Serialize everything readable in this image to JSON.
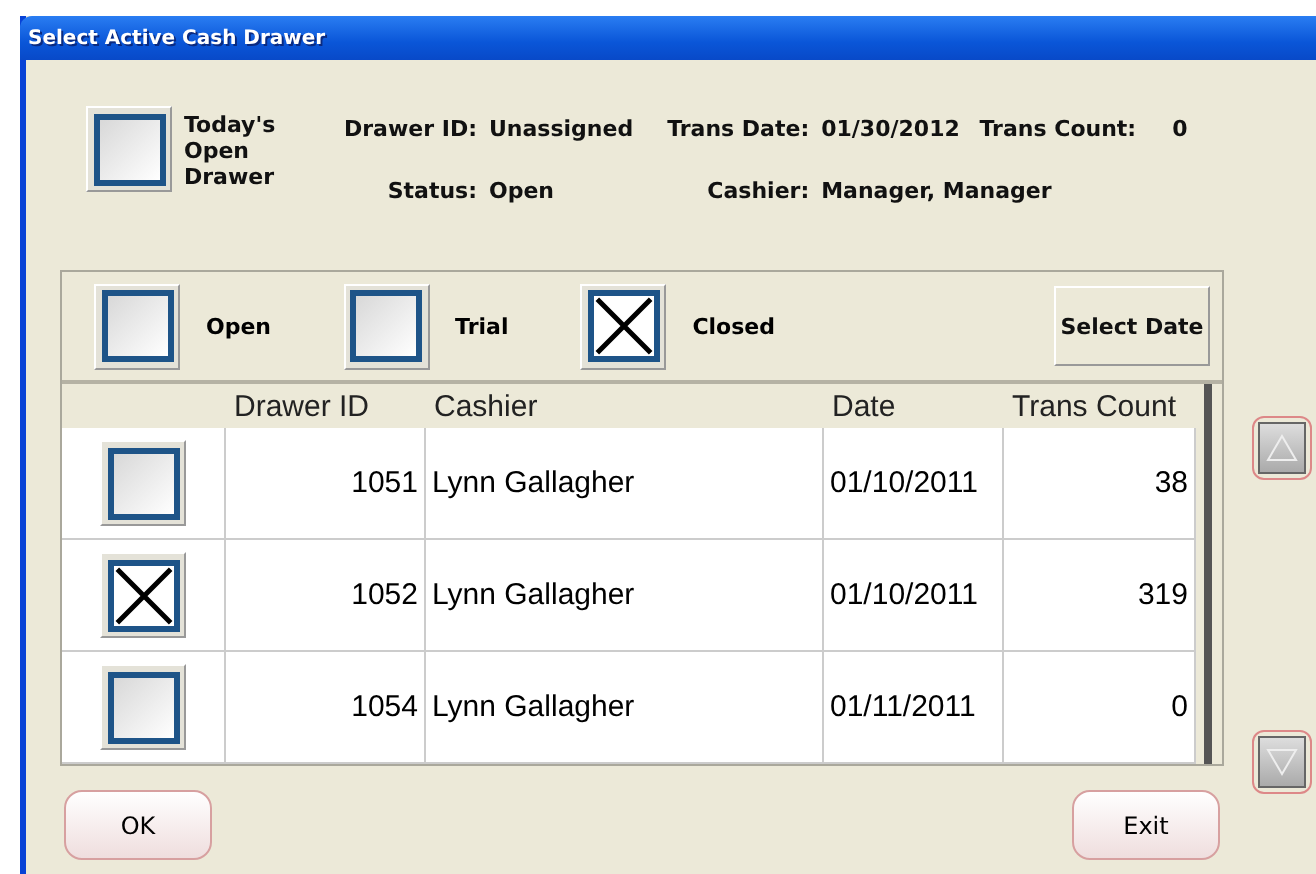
{
  "window": {
    "title": "Select Active Cash Drawer"
  },
  "today_drawer": {
    "label": "Today's Open Drawer",
    "checked": false
  },
  "info_columns": [
    [
      {
        "label": "Drawer ID:",
        "value": "Unassigned"
      },
      {
        "label": "Status:",
        "value": "Open"
      }
    ],
    [
      {
        "label": "Trans Date:",
        "value": "01/30/2012"
      },
      {
        "label": "Cashier:",
        "value": "Manager, Manager"
      }
    ],
    [
      {
        "label": "Trans Count:",
        "value": "0"
      }
    ]
  ],
  "filters": [
    {
      "label": "Open",
      "checked": false
    },
    {
      "label": "Trial",
      "checked": false
    },
    {
      "label": "Closed",
      "checked": true
    }
  ],
  "select_date_button": "Select Date",
  "table": {
    "columns": [
      "Drawer ID",
      "Cashier",
      "Date",
      "Trans Count"
    ],
    "rows": [
      {
        "checked": false,
        "drawer_id": "1051",
        "cashier": "Lynn Gallagher",
        "date": "01/10/2011",
        "trans_count": "38"
      },
      {
        "checked": true,
        "drawer_id": "1052",
        "cashier": "Lynn Gallagher",
        "date": "01/10/2011",
        "trans_count": "319"
      },
      {
        "checked": false,
        "drawer_id": "1054",
        "cashier": "Lynn Gallagher",
        "date": "01/11/2011",
        "trans_count": "0"
      }
    ]
  },
  "buttons": [
    "OK",
    "Exit"
  ]
}
